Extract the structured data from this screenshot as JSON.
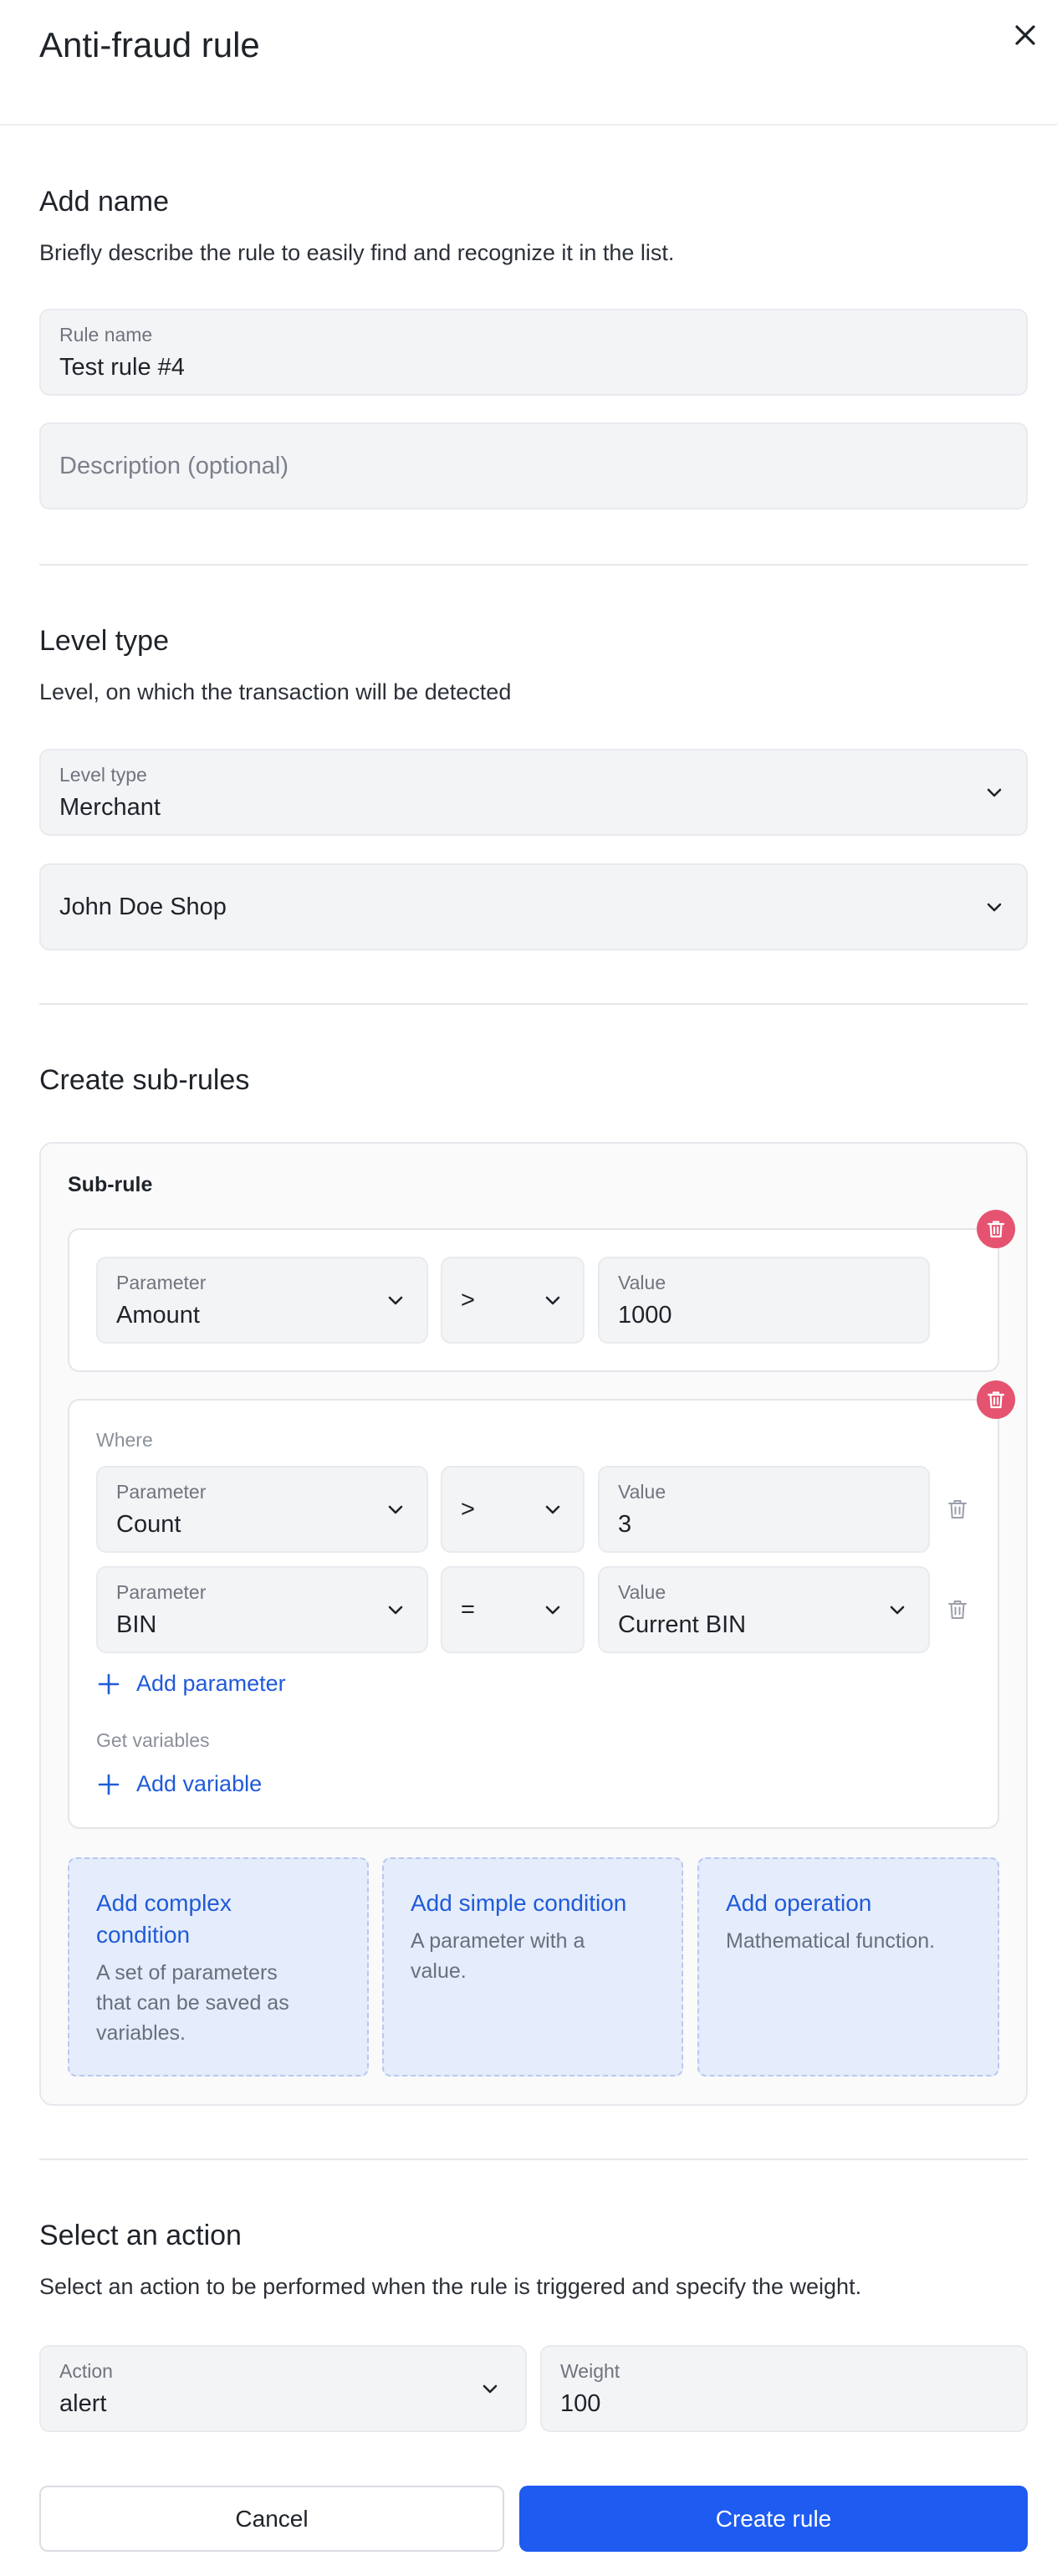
{
  "header": {
    "title": "Anti-fraud rule",
    "close_icon": "close-icon"
  },
  "name_section": {
    "title": "Add name",
    "description": "Briefly describe the rule to easily find and recognize it in the list.",
    "rule_name_label": "Rule name",
    "rule_name_value": "Test rule #4",
    "description_placeholder": "Description (optional)"
  },
  "level_section": {
    "title": "Level type",
    "description": "Level, on which the transaction will be detected",
    "level_type_label": "Level type",
    "level_type_value": "Merchant",
    "merchant_value": "John Doe Shop"
  },
  "subrules_section": {
    "title": "Create sub-rules",
    "subrule_heading": "Sub-rule",
    "main_condition": {
      "parameter_label": "Parameter",
      "parameter_value": "Amount",
      "operator": ">",
      "value_label": "Value",
      "value": "1000"
    },
    "where_block": {
      "where_label": "Where",
      "rows": [
        {
          "parameter_label": "Parameter",
          "parameter_value": "Count",
          "operator": ">",
          "value_label": "Value",
          "value": "3"
        },
        {
          "parameter_label": "Parameter",
          "parameter_value": "BIN",
          "operator": "=",
          "value_label": "Value",
          "value": "Current BIN"
        }
      ],
      "add_parameter": "Add parameter",
      "get_variables_label": "Get variables",
      "add_variable": "Add variable"
    },
    "options": [
      {
        "title_line1": "Add complex",
        "title_line2": "condition",
        "desc_lines": [
          "A set of parameters",
          "that can be saved as",
          "variables."
        ]
      },
      {
        "title_line1": "Add simple condition",
        "desc_lines": [
          "A parameter with a",
          "value."
        ]
      },
      {
        "title_line1": "Add operation",
        "desc_lines": [
          "Mathematical function."
        ]
      }
    ]
  },
  "action_section": {
    "title": "Select an action",
    "description": "Select an action to be performed when the rule is triggered and specify the weight.",
    "action_label": "Action",
    "action_value": "alert",
    "weight_label": "Weight",
    "weight_value": "100"
  },
  "footer": {
    "cancel_label": "Cancel",
    "create_label": "Create rule"
  },
  "colors": {
    "accent": "#1e5bf0",
    "link": "#1f5bd9",
    "danger": "#e55370",
    "option_bg": "#e5ecfb"
  }
}
